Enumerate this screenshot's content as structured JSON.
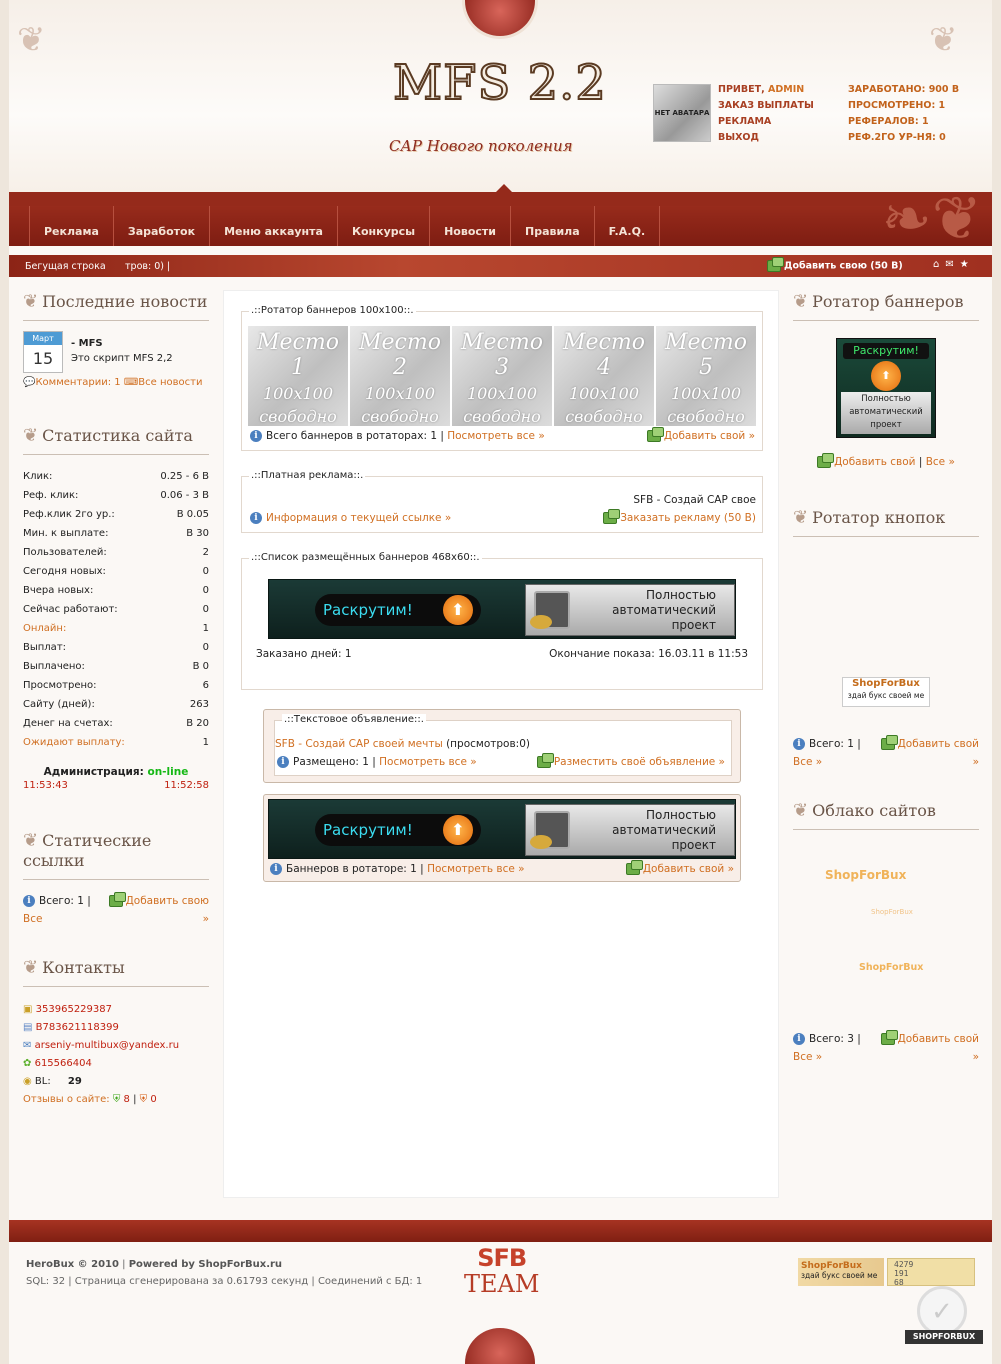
{
  "header": {
    "logo": "MFS 2.2",
    "slogan": "САР Нового поколения",
    "avatar_text": "НЕТ АВАТАРА",
    "greeting_prefix": "ПРИВЕТ, ",
    "username": "ADMIN",
    "links": [
      "ЗАКАЗ ВЫПЛАТЫ",
      "РЕКЛАМА",
      "ВЫХОД"
    ],
    "stats": [
      "ЗАРАБОТАНО: 900 В",
      "ПРОСМОТРЕНО: 1",
      "РЕФЕРАЛОВ: 1",
      "РЕФ.2ГО УР-НЯ: 0"
    ]
  },
  "nav": [
    "Реклама",
    "Заработок",
    "Меню аккаунта",
    "Конкурсы",
    "Новости",
    "Правила",
    "F.A.Q."
  ],
  "ticker": {
    "label": "Бегущая строка",
    "text": "тров: 0)  |",
    "add": "Добавить свою (50 В)"
  },
  "left": {
    "news": {
      "title": "Последние новости",
      "cal_month": "Март",
      "cal_day": "15",
      "item_title": "- MFS",
      "item_text": "Это скрипт MFS 2,2",
      "comments": "Комментарии: 1",
      "all": "Все новости"
    },
    "stats": {
      "title": "Статистика сайта",
      "rows": [
        {
          "k": "Клик:",
          "v": "0.25 - 6 В"
        },
        {
          "k": "Реф. клик:",
          "v": "0.06 - 3 В"
        },
        {
          "k": "Реф.клик 2го ур.:",
          "v": "В 0.05"
        },
        {
          "k": "Мин. к выплате:",
          "v": "В 30"
        },
        {
          "k": "Пользователей:",
          "v": "2"
        },
        {
          "k": "Сегодня новых:",
          "v": "0"
        },
        {
          "k": "Вчера новых:",
          "v": "0"
        },
        {
          "k": "Сейчас работают:",
          "v": "0"
        },
        {
          "k": "Онлайн:",
          "v": "1"
        },
        {
          "k": "Выплат:",
          "v": "0"
        },
        {
          "k": "Выплачено:",
          "v": "В 0"
        },
        {
          "k": "Просмотрено:",
          "v": "6"
        },
        {
          "k": "Сайту (дней):",
          "v": "263"
        },
        {
          "k": "Денег на счетах:",
          "v": "В  20"
        },
        {
          "k": "Ожидают выплату:",
          "v": "1"
        }
      ],
      "admin_label": "Администрация:",
      "admin_status": "on-line",
      "time1": "11:53:43",
      "time2": "11:52:58"
    },
    "links": {
      "title": "Статические ссылки",
      "total": "Всего: 1 |",
      "add": "Добавить свою",
      "all": "Все",
      "arrow": "»"
    },
    "contacts": {
      "title": "Контакты",
      "icq": "353965229387",
      "wm": "B783621118399",
      "email": "arseniy-multibux@yandex.ru",
      "icq2": "615566404",
      "bl_label": "BL:",
      "bl_value": "29",
      "reviews": "Отзывы о сайте:",
      "good": "8",
      "bad": "0"
    }
  },
  "center": {
    "rotator": {
      "title": ".::Ротатор баннеров 100х100::.",
      "places": [
        {
          "a": "Место 1",
          "b": "100x100",
          "c": "свободно"
        },
        {
          "a": "Место 2",
          "b": "100x100",
          "c": "свободно"
        },
        {
          "a": "Место 3",
          "b": "100x100",
          "c": "свободно"
        },
        {
          "a": "Место 4",
          "b": "100x100",
          "c": "свободно"
        },
        {
          "a": "Место 5",
          "b": "100x100",
          "c": "свободно"
        }
      ],
      "total": "Всего баннеров в ротаторах: 1 |",
      "view_all": "Посмотреть все »",
      "add": "Добавить свой »"
    },
    "paid": {
      "title": ".::Платная реклама::.",
      "text": "SFB - Создай САР свое",
      "info": "Информация о текущей ссылке »",
      "order": "Заказать рекламу (50 В)"
    },
    "list468": {
      "title": ".::Список размещённых баннеров 468х60::.",
      "days": "Заказано дней: 1",
      "end": "Окончание показа: 16.03.11 в 11:53"
    },
    "banner": {
      "left": "Раскрутим!",
      "right": [
        "Полностью",
        "автоматический",
        "проект"
      ]
    },
    "textad": {
      "title": ".::Текстовое объявление::.",
      "link": "SFB - Создай САР своей мечты",
      "views": " (просмотров:0)",
      "placed": "Размещено: 1 |",
      "view_all": "Посмотреть все »",
      "add": "Разместить своё объявление »"
    },
    "rot2": {
      "total": "Баннеров в ротаторе: 1 |",
      "view_all": "Посмотреть все »",
      "add": "Добавить свой »"
    }
  },
  "right": {
    "rotator": {
      "title": "Ротатор баннеров",
      "banner_top": "Раскрутим!",
      "banner_lines": [
        "Полностью",
        "автоматический",
        "проект"
      ],
      "add": "Добавить свой",
      "all": "Все »"
    },
    "buttons": {
      "title": "Ротатор кнопок",
      "btn_title": "ShopForBux",
      "btn_sub": "здай букс своей ме",
      "total": "Всего: 1 |",
      "add": "Добавить свой",
      "all": "Все »",
      "arrow": "»"
    },
    "cloud": {
      "title": "Облако сайтов",
      "w1": "ShopForBux",
      "w2": "ShopForBux",
      "w3": "ShopForBux",
      "total": "Всего: 3 |",
      "add": "Добавить свой",
      "all": "Все »",
      "arrow": "»"
    }
  },
  "footer": {
    "copy": "HeroBux © 2010",
    "powered_prefix": "Powered by ",
    "powered": "ShopForBux.ru",
    "stats": "SQL: 32 | Страница сгенерирована за 0.61793 секунд | Соединений с БД: 1",
    "sfb": "SFB",
    "team": "TEAM",
    "counter_title": "ShopForBux",
    "counter_sub": "здай букс своей ме",
    "counter_nums": [
      "4279",
      "191",
      "68"
    ],
    "seal": "SHOPFORBUX"
  }
}
